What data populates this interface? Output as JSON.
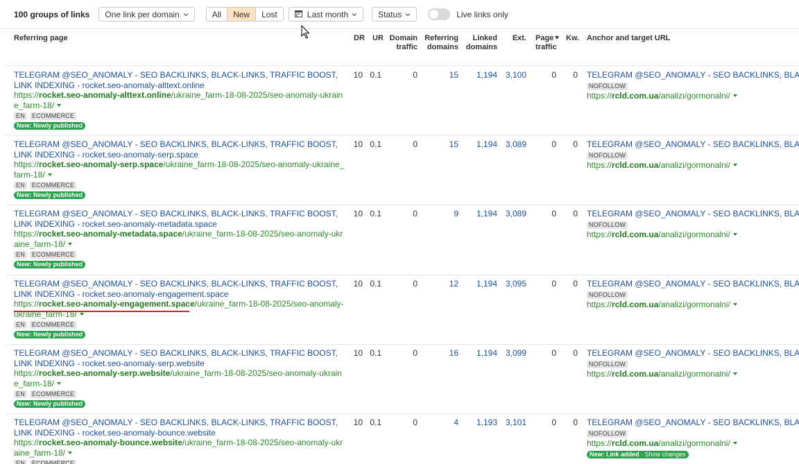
{
  "toolbar": {
    "title": "100 groups of links",
    "grouping": "One link per domain",
    "filter_all": "All",
    "filter_new": "New",
    "filter_lost": "Lost",
    "period": "Last month",
    "status": "Status",
    "live_only": "Live links only",
    "live_only_on": false
  },
  "columns": {
    "referring_page": "Referring page",
    "dr": "DR",
    "ur": "UR",
    "domain_traffic_1": "Domain",
    "domain_traffic_2": "traffic",
    "referring_domains_1": "Referring",
    "referring_domains_2": "domains",
    "linked_domains_1": "Linked",
    "linked_domains_2": "domains",
    "ext": "Ext.",
    "page_traffic_1": "Page",
    "page_traffic_2": "traffic",
    "kw": "Kw.",
    "anchor": "Anchor and target URL"
  },
  "rows": [
    {
      "title": "TELEGRAM @SEO_ANOMALY - SEO BACKLINKS, BLACK-LINKS, TRAFFIC BOOST, LINK INDEXING - rocket.seo-anomaly-alttext.online",
      "url_prefix": "https://",
      "url_domain": "rocket.seo-anomaly-alttext.online",
      "url_path": "/ukraine_farm-18-08-2025/seo-anomaly-ukraine_farm-18/",
      "tag_lang": "EN",
      "tag_cat": "ECOMMERCE",
      "badge": "New: Newly published",
      "dr": "10",
      "ur": "0.1",
      "domain_traffic": "0",
      "referring_domains": "15",
      "linked_domains": "1,194",
      "ext": "3,100",
      "page_traffic": "0",
      "kw": "0",
      "anchor_title": "TELEGRAM @SEO_ANOMALY - SEO BACKLINKS, BLACK-LINKS",
      "nofollow": "NOFOLLOW",
      "target_prefix": "https://",
      "target_domain": "rcld.com.ua",
      "target_path": "/analizi/gormonalni/"
    },
    {
      "title": "TELEGRAM @SEO_ANOMALY - SEO BACKLINKS, BLACK-LINKS, TRAFFIC BOOST, LINK INDEXING - rocket.seo-anomaly-serp.space",
      "url_prefix": "https://",
      "url_domain": "rocket.seo-anomaly-serp.space",
      "url_path": "/ukraine_farm-18-08-2025/seo-anomaly-ukraine_farm-18/",
      "tag_lang": "EN",
      "tag_cat": "ECOMMERCE",
      "badge": "New: Newly published",
      "dr": "10",
      "ur": "0.1",
      "domain_traffic": "0",
      "referring_domains": "15",
      "linked_domains": "1,194",
      "ext": "3,089",
      "page_traffic": "0",
      "kw": "0",
      "anchor_title": "TELEGRAM @SEO_ANOMALY - SEO BACKLINKS, BLACK-LINKS",
      "nofollow": "NOFOLLOW",
      "target_prefix": "https://",
      "target_domain": "rcld.com.ua",
      "target_path": "/analizi/gormonalni/"
    },
    {
      "title": "TELEGRAM @SEO_ANOMALY - SEO BACKLINKS, BLACK-LINKS, TRAFFIC BOOST, LINK INDEXING - rocket.seo-anomaly-metadata.space",
      "url_prefix": "https://",
      "url_domain": "rocket.seo-anomaly-metadata.space",
      "url_path": "/ukraine_farm-18-08-2025/seo-anomaly-ukraine_farm-18/",
      "tag_lang": "EN",
      "tag_cat": "ECOMMERCE",
      "badge": "New: Newly published",
      "dr": "10",
      "ur": "0.1",
      "domain_traffic": "0",
      "referring_domains": "9",
      "linked_domains": "1,194",
      "ext": "3,089",
      "page_traffic": "0",
      "kw": "0",
      "anchor_title": "TELEGRAM @SEO_ANOMALY - SEO BACKLINKS, BLACK-LINKS",
      "nofollow": "NOFOLLOW",
      "target_prefix": "https://",
      "target_domain": "rcld.com.ua",
      "target_path": "/analizi/gormonalni/"
    },
    {
      "title": "TELEGRAM @SEO_ANOMALY - SEO BACKLINKS, BLACK-LINKS, TRAFFIC BOOST, LINK INDEXING - rocket.seo-anomaly-engagement.space",
      "url_prefix": "https://",
      "url_domain": "rocket.seo-anomaly-engagement.space",
      "url_path": "/ukraine_farm-18-08-2025/seo-anomaly-ukraine_farm-18/",
      "tag_lang": "EN",
      "tag_cat": "ECOMMERCE",
      "badge": "New: Newly published",
      "dr": "10",
      "ur": "0.1",
      "domain_traffic": "0",
      "referring_domains": "12",
      "linked_domains": "1,194",
      "ext": "3,095",
      "page_traffic": "0",
      "kw": "0",
      "anchor_title": "TELEGRAM @SEO_ANOMALY - SEO BACKLINKS, BLACK-LINKS",
      "nofollow": "NOFOLLOW",
      "target_prefix": "https://",
      "target_domain": "rcld.com.ua",
      "target_path": "/analizi/gormonalni/"
    },
    {
      "title": "TELEGRAM @SEO_ANOMALY - SEO BACKLINKS, BLACK-LINKS, TRAFFIC BOOST, LINK INDEXING - rocket.seo-anomaly-serp.website",
      "url_prefix": "https://",
      "url_domain": "rocket.seo-anomaly-serp.website",
      "url_path": "/ukraine_farm-18-08-2025/seo-anomaly-ukraine_farm-18/",
      "tag_lang": "EN",
      "tag_cat": "ECOMMERCE",
      "badge": "New: Newly published",
      "dr": "10",
      "ur": "0.1",
      "domain_traffic": "0",
      "referring_domains": "16",
      "linked_domains": "1,194",
      "ext": "3,099",
      "page_traffic": "0",
      "kw": "0",
      "anchor_title": "TELEGRAM @SEO_ANOMALY - SEO BACKLINKS, BLACK-LINKS",
      "nofollow": "NOFOLLOW",
      "target_prefix": "https://",
      "target_domain": "rcld.com.ua",
      "target_path": "/analizi/gormonalni/"
    },
    {
      "title": "TELEGRAM @SEO_ANOMALY - SEO BACKLINKS, BLACK-LINKS, TRAFFIC BOOST, LINK INDEXING - rocket.seo-anomaly-bounce.website",
      "url_prefix": "https://",
      "url_domain": "rocket.seo-anomaly-bounce.website",
      "url_path": "/ukraine_farm-18-08-2025/seo-anomaly-ukraine_farm-18/",
      "tag_lang": "EN",
      "tag_cat": "ECOMMERCE",
      "badge": "",
      "dr": "10",
      "ur": "0.1",
      "domain_traffic": "0",
      "referring_domains": "4",
      "linked_domains": "1,193",
      "ext": "3,101",
      "page_traffic": "0",
      "kw": "0",
      "anchor_title": "TELEGRAM @SEO_ANOMALY - SEO BACKLINKS, BLACK-LINKS",
      "nofollow": "NOFOLLOW",
      "target_prefix": "https://",
      "target_domain": "rcld.com.ua",
      "target_path": "/analizi/gormonalni/",
      "link_badge": "New: Link added",
      "link_badge_extra": " · Show changes"
    }
  ]
}
